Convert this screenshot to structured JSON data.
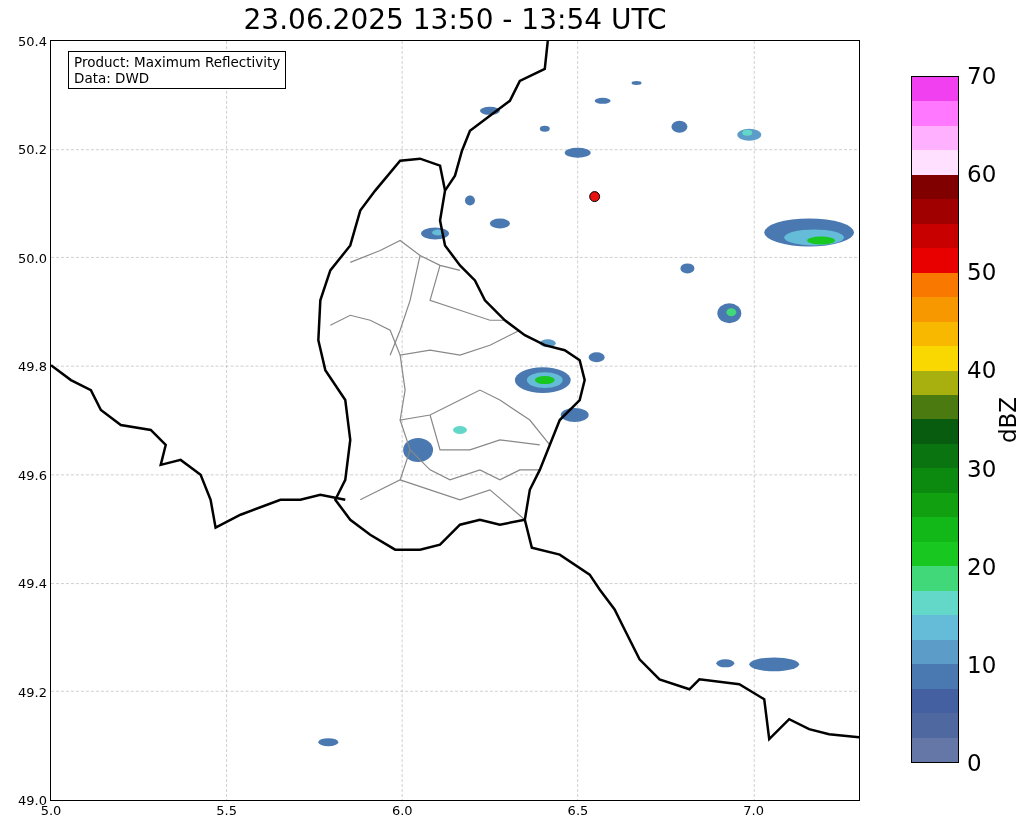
{
  "title": "23.06.2025 13:50 - 13:54 UTC",
  "info_box": {
    "lines": [
      "Product: Maximum Reflectivity",
      "Data: DWD"
    ]
  },
  "map": {
    "xticks": [
      "5.0",
      "5.5",
      "6.0",
      "6.5",
      "7.0"
    ],
    "yticks": [
      "50.4",
      "50.2",
      "50.0",
      "49.8",
      "49.6",
      "49.4",
      "49.2",
      "49.0"
    ]
  },
  "colorbar": {
    "label": "dBZ",
    "ticks": [
      "70",
      "60",
      "50",
      "40",
      "30",
      "20",
      "10",
      "0"
    ],
    "bands": [
      {
        "color": "#6577a6"
      },
      {
        "color": "#5068a0"
      },
      {
        "color": "#4460a0"
      },
      {
        "color": "#4a78b0"
      },
      {
        "color": "#5c9cc8"
      },
      {
        "color": "#64bcd8"
      },
      {
        "color": "#64d8c8"
      },
      {
        "color": "#40d878"
      },
      {
        "color": "#18c820"
      },
      {
        "color": "#12b818"
      },
      {
        "color": "#10a010"
      },
      {
        "color": "#0c8a10"
      },
      {
        "color": "#0a7410"
      },
      {
        "color": "#085c10"
      },
      {
        "color": "#4a7a10"
      },
      {
        "color": "#a8b010"
      },
      {
        "color": "#f8d800"
      },
      {
        "color": "#f8b800"
      },
      {
        "color": "#f89800"
      },
      {
        "color": "#f87800"
      },
      {
        "color": "#e80000"
      },
      {
        "color": "#c80000"
      },
      {
        "color": "#a00000"
      },
      {
        "color": "#800000"
      },
      {
        "color": "#ffe0ff"
      },
      {
        "color": "#ffb0ff"
      },
      {
        "color": "#ff78ff"
      },
      {
        "color": "#f040f0"
      }
    ]
  }
}
